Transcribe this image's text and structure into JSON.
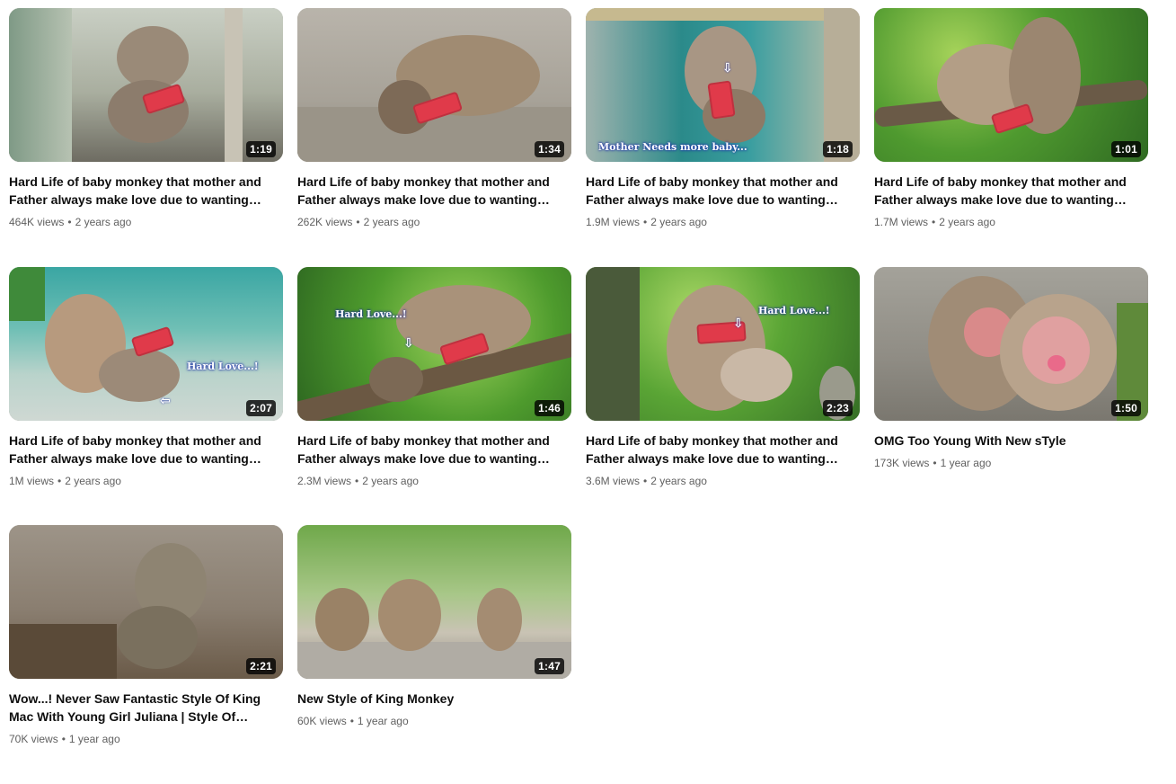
{
  "videos": [
    {
      "title": "Hard Life of baby monkey that mother and Father always make love due to wanting on…",
      "duration": "1:19",
      "views": "464K views",
      "age": "2 years ago",
      "overlay": ""
    },
    {
      "title": "Hard Life of baby monkey that mother and Father always make love due to wanting on…",
      "duration": "1:34",
      "views": "262K views",
      "age": "2 years ago",
      "overlay": ""
    },
    {
      "title": "Hard Life of baby monkey that mother and Father always make love due to wanting on…",
      "duration": "1:18",
      "views": "1.9M views",
      "age": "2 years ago",
      "overlay": "Mother Needs more baby..."
    },
    {
      "title": "Hard Life of baby monkey that mother and Father always make love due to wanting on…",
      "duration": "1:01",
      "views": "1.7M views",
      "age": "2 years ago",
      "overlay": ""
    },
    {
      "title": "Hard Life of baby monkey that mother and Father always make love due to wanting on…",
      "duration": "2:07",
      "views": "1M views",
      "age": "2 years ago",
      "overlay": "Hard Love...!"
    },
    {
      "title": "Hard Life of baby monkey that mother and Father always make love due to wanting on…",
      "duration": "1:46",
      "views": "2.3M views",
      "age": "2 years ago",
      "overlay": "Hard Love...!"
    },
    {
      "title": "Hard Life of baby monkey that mother and Father always make love due to wanting on…",
      "duration": "2:23",
      "views": "3.6M views",
      "age": "2 years ago",
      "overlay": "Hard Love...!"
    },
    {
      "title": "OMG Too Young With New sTyle",
      "duration": "1:50",
      "views": "173K views",
      "age": "1 year ago",
      "overlay": ""
    },
    {
      "title": "Wow...! Never Saw Fantastic Style Of King Mac With Young Girl Juliana | Style Of King…",
      "duration": "2:21",
      "views": "70K views",
      "age": "1 year ago",
      "overlay": ""
    },
    {
      "title": "New Style of King Monkey",
      "duration": "1:47",
      "views": "60K views",
      "age": "1 year ago",
      "overlay": ""
    }
  ],
  "separator": "•",
  "colors": {
    "duration_bg": "#000000",
    "meta_text": "#606060",
    "censor_bar": "#e03a4a",
    "overlay_glow": "#1a2aa8"
  }
}
